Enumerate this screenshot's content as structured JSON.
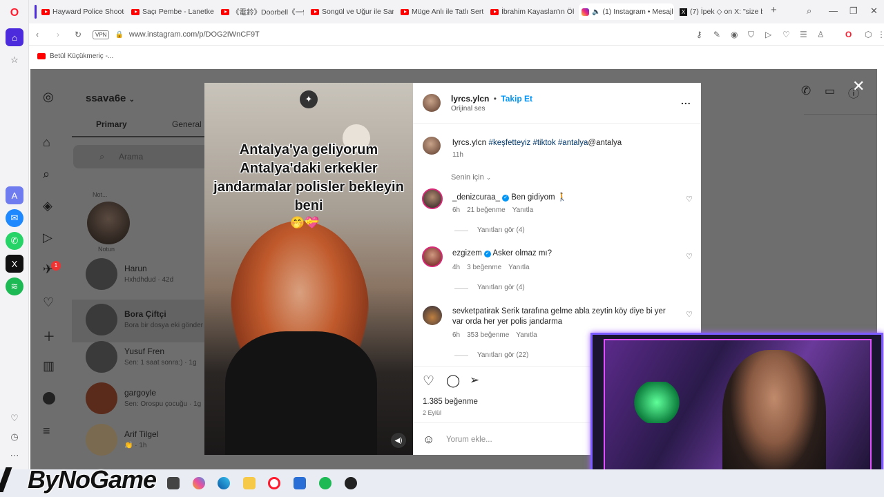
{
  "browser": {
    "tabs": [
      {
        "label": "Hayward Police Shooto",
        "icon": "youtube-icon"
      },
      {
        "label": "Saçı Pembe - Lanetkel",
        "icon": "youtube-icon"
      },
      {
        "label": "《電鈴》Doorbell《一個人",
        "icon": "youtube-icon"
      },
      {
        "label": "Songül ve Uğur ile Sana",
        "icon": "youtube-icon"
      },
      {
        "label": "Müge Anlı ile Tatlı Sert",
        "icon": "youtube-icon"
      },
      {
        "label": "İbrahim Kayaslan'ın Ölü",
        "icon": "youtube-icon"
      },
      {
        "label": "(1) Instagram • Mesajl",
        "icon": "instagram-icon"
      },
      {
        "label": "(7) İpek ◇ on X: \"size bi",
        "icon": "x-icon"
      }
    ],
    "new_tab": "+",
    "vpn_label": "VPN",
    "url": "www.instagram.com/p/DOG2IWnCF9T",
    "bookmark": "Betül Küçükmeriç -..."
  },
  "instagram": {
    "account": "ssava6e",
    "tabs": [
      "Primary",
      "General"
    ],
    "search_placeholder": "Arama",
    "note_label": "Not...",
    "note_caption": "Notun",
    "conversations": [
      {
        "name": "Harun",
        "sub": "Hxhdhdud · 42d"
      },
      {
        "name": "Bora Çiftçi",
        "sub": "Bora bir dosya eki gönder"
      },
      {
        "name": "Yusuf Fren",
        "sub": "Sen: 1 saat sonra:) · 1g"
      },
      {
        "name": "gargoyle",
        "sub": "Sen: Orospu çocuğu · 1g"
      },
      {
        "name": "Arif Tilgel",
        "sub": "👏 · 1h"
      }
    ],
    "notification_count": "1"
  },
  "post": {
    "author": "lyrcs.ylcn",
    "follow": "Takip Et",
    "audio": "Orijinal ses",
    "more": "...",
    "caption_user": "lyrcs.ylcn",
    "caption_tags": "#keşfetteyiz #tiktok #antalya",
    "caption_mention": "@antalya",
    "caption_time": "11h",
    "for_you": "Senin için",
    "video_text": "Antalya'ya geliyorum Antalya'daki erkekler jandarmalar polisler bekleyin beni",
    "video_emoji": "🤭💝",
    "comments": [
      {
        "user": "_denizcuraa_",
        "verified": true,
        "text": "Ben gidiyom 🚶",
        "time": "6h",
        "likes": "21 beğenme",
        "reply": "Yanıtla",
        "view_replies": "Yanıtları gör (4)"
      },
      {
        "user": "ezgizem",
        "verified": true,
        "text": "Asker olmaz mı?",
        "time": "4h",
        "likes": "3 beğenme",
        "reply": "Yanıtla",
        "view_replies": "Yanıtları gör (4)"
      },
      {
        "user": "sevketpatirak",
        "verified": false,
        "text": "Serik tarafına gelme abla zeytin köy diye bi yer var orda her yer polis jandarma",
        "time": "6h",
        "likes": "353 beğenme",
        "reply": "Yanıtla",
        "view_replies": "Yanıtları gör (22)"
      }
    ],
    "likes_total": "1.385 beğenme",
    "date": "2 Eylül",
    "comment_placeholder": "Yorum ekle..."
  },
  "overlay": {
    "brand": "ByNoGame"
  },
  "colors": {
    "accent": "#0095f6",
    "opera_red": "#ff1b2d",
    "webcam_border": "#7b5cff"
  }
}
